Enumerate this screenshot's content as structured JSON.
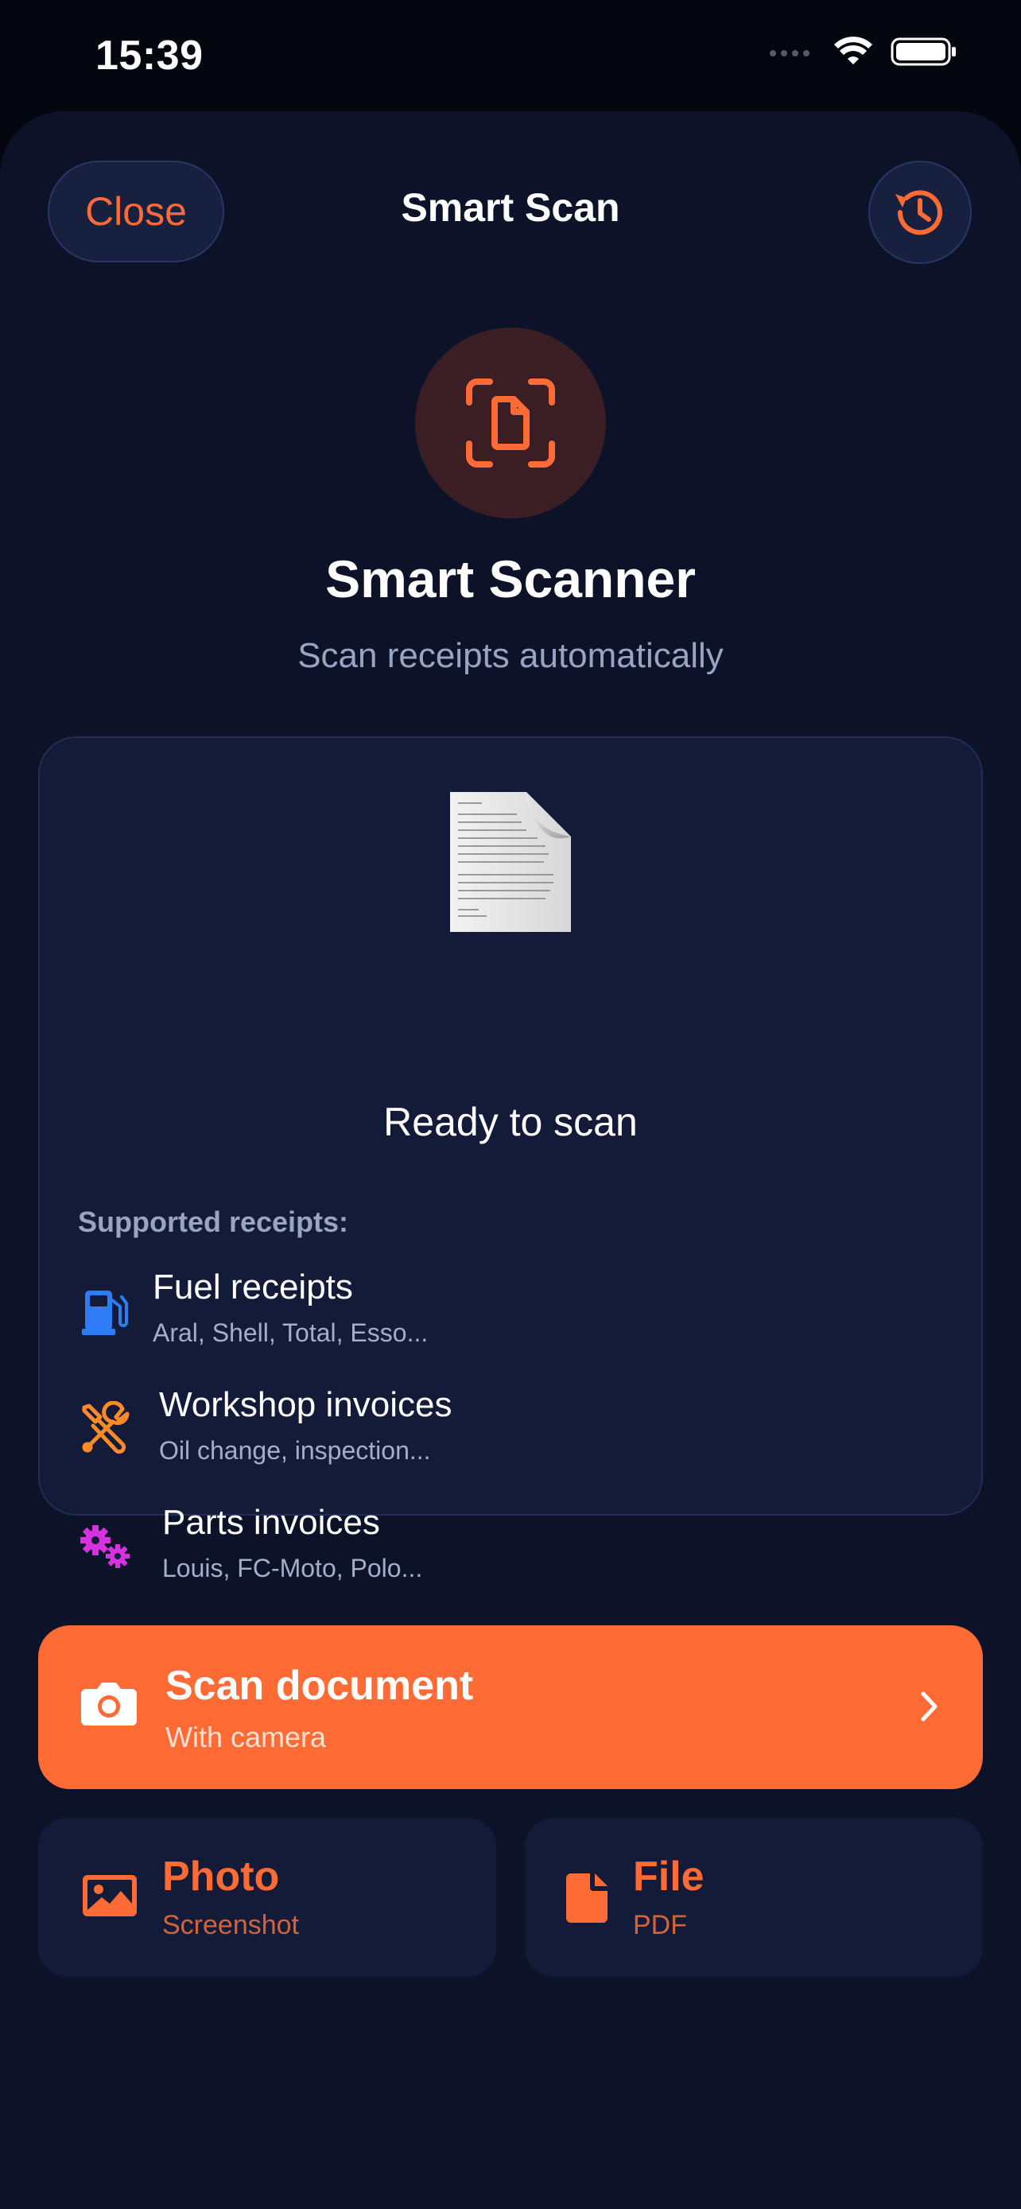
{
  "status_bar": {
    "time": "15:39"
  },
  "header": {
    "close_label": "Close",
    "title": "Smart Scan",
    "history_icon": "history-icon"
  },
  "hero": {
    "icon": "document-scanner-icon",
    "title": "Smart Scanner",
    "subtitle": "Scan receipts automatically"
  },
  "card": {
    "status": "Ready to scan",
    "supported_label": "Supported receipts:",
    "items": [
      {
        "icon": "fuel-pump-icon",
        "icon_color": "#2f7df6",
        "title": "Fuel receipts",
        "subtitle": "Aral, Shell, Total, Esso..."
      },
      {
        "icon": "wrench-screwdriver-icon",
        "icon_color": "#ff8a2a",
        "title": "Workshop invoices",
        "subtitle": "Oil change, inspection..."
      },
      {
        "icon": "gears-icon",
        "icon_color": "#d633e0",
        "title": "Parts invoices",
        "subtitle": "Louis, FC-Moto, Polo..."
      }
    ]
  },
  "actions": {
    "scan": {
      "title": "Scan document",
      "subtitle": "With camera",
      "icon": "camera-icon"
    },
    "photo": {
      "title": "Photo",
      "subtitle": "Screenshot",
      "icon": "image-icon"
    },
    "file": {
      "title": "File",
      "subtitle": "PDF",
      "icon": "file-icon"
    }
  },
  "colors": {
    "accent": "#ff6b35",
    "background": "#0c1329",
    "card": "#141b38"
  }
}
